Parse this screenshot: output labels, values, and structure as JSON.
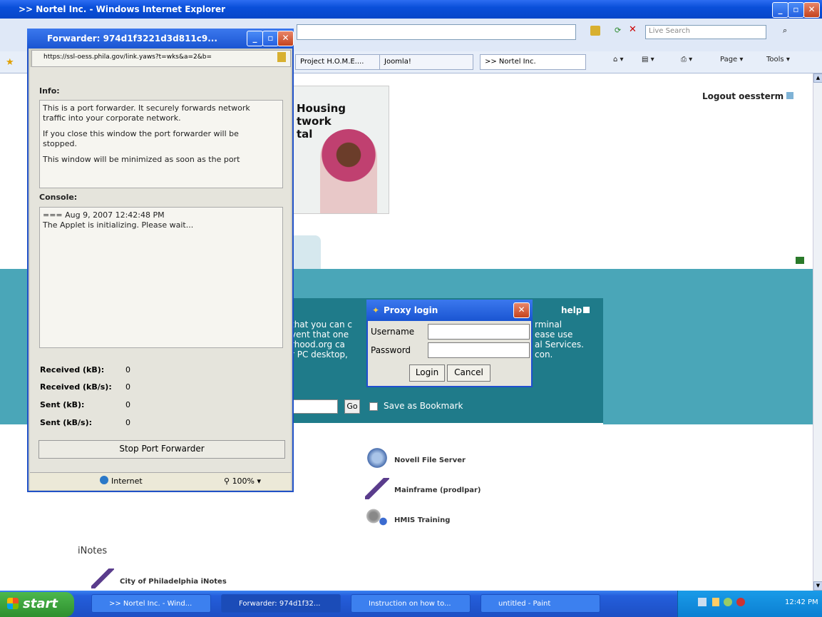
{
  "ie": {
    "title": ">> Nortel Inc. - Windows Internet Explorer",
    "search_placeholder": "Live Search",
    "tabs": [
      {
        "label": "Project H.O.M.E...."
      },
      {
        "label": "Joomla!"
      },
      {
        "label": ">> Nortel Inc."
      }
    ],
    "commands": [
      "Page",
      "Tools"
    ]
  },
  "page": {
    "logout": "Logout oessterm",
    "logo_lines": [
      "Housing",
      "twork",
      "tal"
    ],
    "help": "help",
    "intro_left": [
      "that you can c",
      "vent that one",
      "rhood.org ca",
      "r PC desktop,"
    ],
    "intro_right": [
      "rminal",
      "ease use",
      "al Services.",
      "con."
    ],
    "go": "Go",
    "save_bookmark": "Save as Bookmark",
    "apps": [
      {
        "label": "Novell File Server",
        "icon": "server-icon"
      },
      {
        "label": "Mainframe (prodlpar)",
        "icon": "mainframe-icon"
      },
      {
        "label": "HMIS Training",
        "icon": "gears-icon"
      }
    ],
    "notes_heading": "iNotes",
    "notes_item": "City of Philadelphia iNotes"
  },
  "forwarder": {
    "title": "Forwarder: 974d1f3221d3d811c9...",
    "address": "https://ssl-oess.phila.gov/link.yaws?t=wks&a=2&b=",
    "info_label": "Info:",
    "info_text": [
      "This is a port forwarder. It securely forwards network traffic into your corporate network.",
      "If you close this window the port forwarder will be stopped.",
      "This window will be minimized as soon as the port"
    ],
    "console_label": "Console:",
    "console_lines": [
      "=== Aug 9, 2007 12:42:48 PM",
      "The Applet is initializing. Please wait..."
    ],
    "stats": [
      {
        "label": "Received (kB):",
        "value": "0"
      },
      {
        "label": "Received (kB/s):",
        "value": "0"
      },
      {
        "label": "Sent (kB):",
        "value": "0"
      },
      {
        "label": "Sent (kB/s):",
        "value": "0"
      }
    ],
    "stop_button": "Stop Port Forwarder",
    "status_zone": "Internet",
    "zoom": "100%"
  },
  "proxy": {
    "title": "Proxy login",
    "username_label": "Username",
    "password_label": "Password",
    "login": "Login",
    "cancel": "Cancel"
  },
  "taskbar": {
    "start": "start",
    "items": [
      {
        "label": ">> Nortel Inc. - Wind..."
      },
      {
        "label": "Forwarder: 974d1f32..."
      },
      {
        "label": "Instruction on how to..."
      },
      {
        "label": "untitled - Paint"
      }
    ],
    "clock": "12:42 PM"
  }
}
